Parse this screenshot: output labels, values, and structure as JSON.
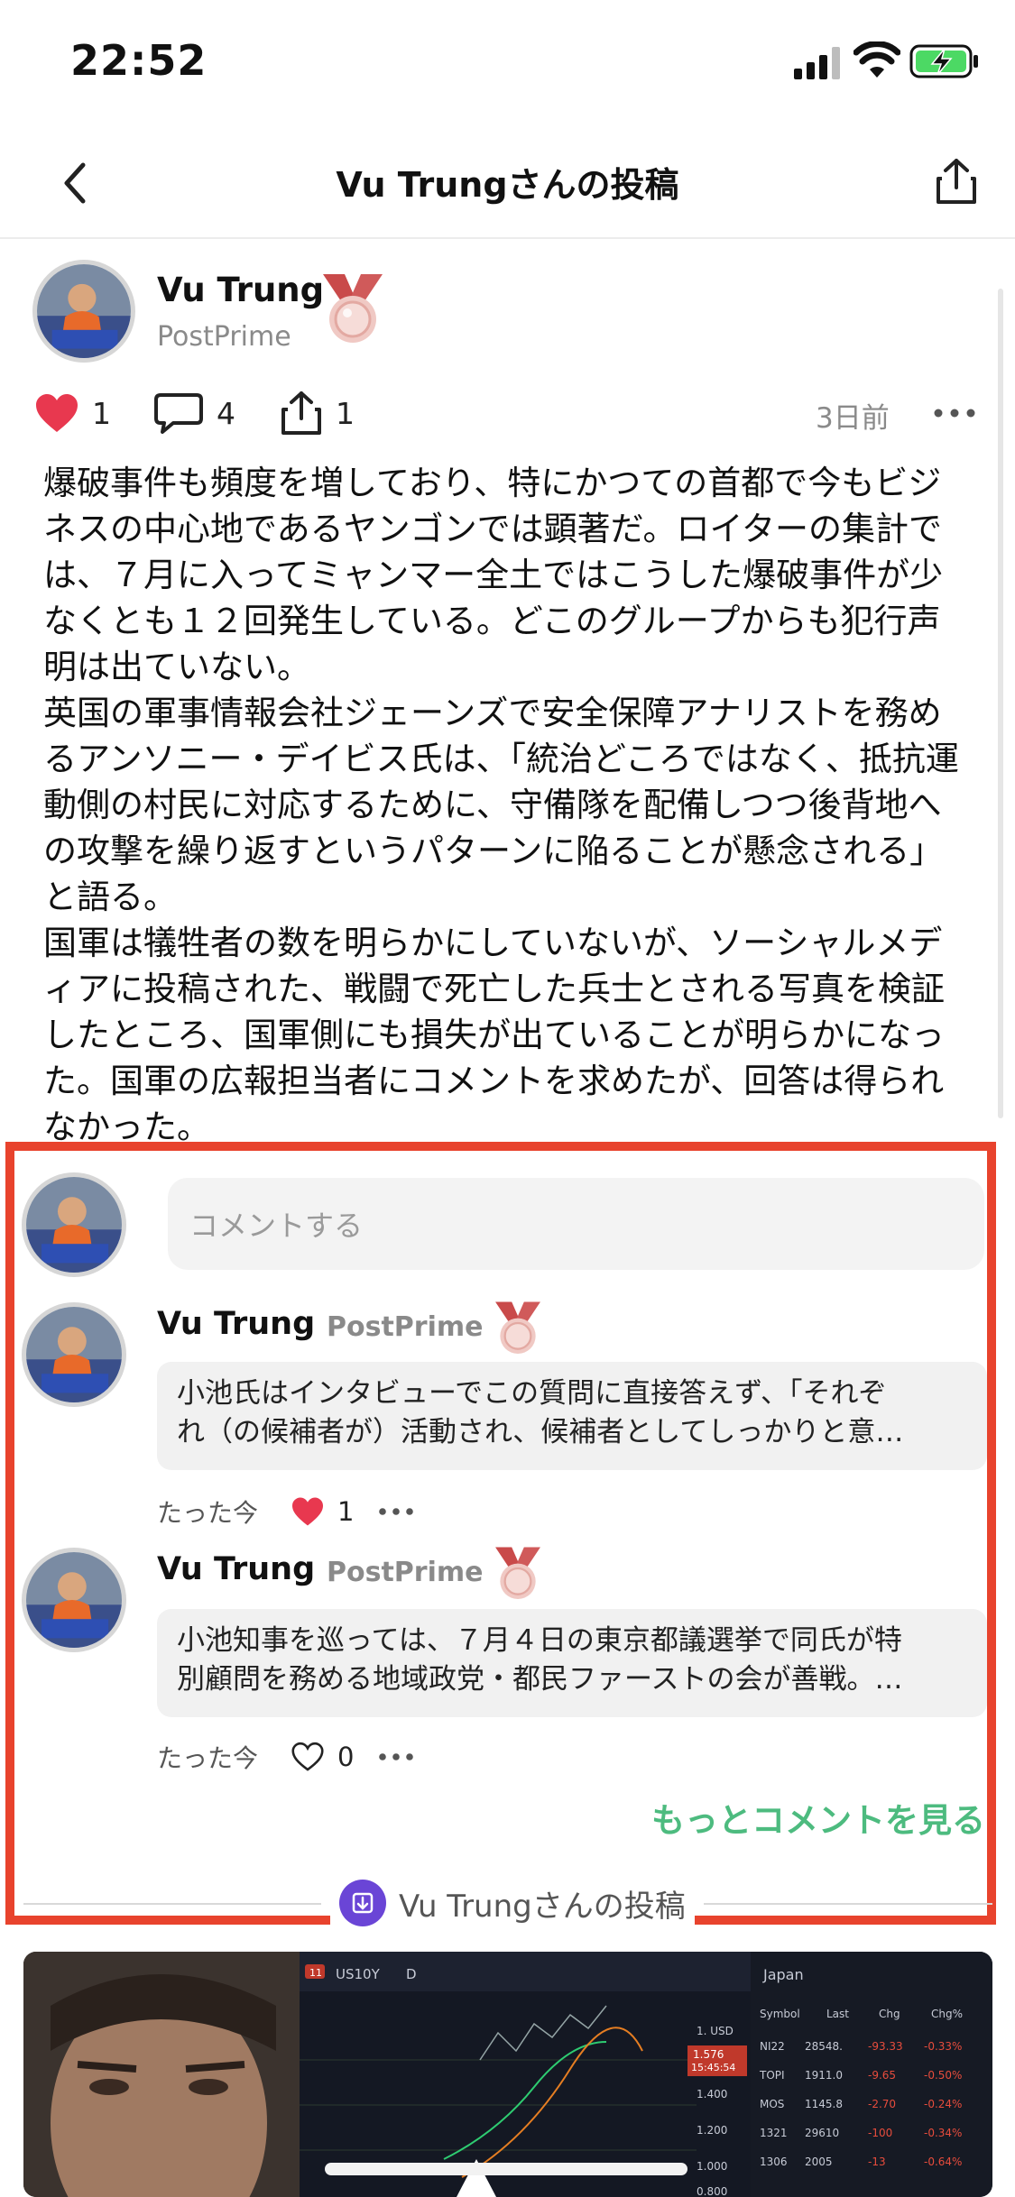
{
  "status": {
    "time": "22:52"
  },
  "nav": {
    "title": "Vu Trungさんの投稿"
  },
  "post": {
    "author": "Vu Trung",
    "subtitle": "PostPrime",
    "likes": "1",
    "comments": "4",
    "shares": "1",
    "time": "3日前",
    "body": [
      "爆破事件も頻度を増しており、特にかつての首都で今もビジネスの中心地であるヤンゴンでは顕著だ。ロイターの集計では、７月に入ってミャンマー全土ではこうした爆破事件が少なくとも１２回発生している。どこのグループからも犯行声明は出ていない。",
      "英国の軍事情報会社ジェーンズで安全保障アナリストを務めるアンソニー・デイビス氏は、「統治どころではなく、抵抗運動側の村民に対応するために、守備隊を配備しつつ後背地への攻撃を繰り返すというパターンに陥ることが懸念される」と語る。",
      "国軍は犠牲者の数を明らかにしていないが、ソーシャルメディアに投稿された、戦闘で死亡した兵士とされる写真を検証したところ、国軍側にも損失が出ていることが明らかになった。国軍の広報担当者にコメントを求めたが、回答は得られなかった。"
    ]
  },
  "comment_input": {
    "placeholder": "コメントする"
  },
  "comments": [
    {
      "author": "Vu Trung",
      "subtitle": "PostPrime",
      "line1": "小池氏はインタビューでこの質問に直接答えず、「それぞ",
      "line2": "れ（の候補者が）活動され、候補者としてしっかりと意…",
      "time": "たった今",
      "likes": "1",
      "liked": true
    },
    {
      "author": "Vu Trung",
      "subtitle": "PostPrime",
      "line1": "小池知事を巡っては、７月４日の東京都議選挙で同氏が特",
      "line2": "別顧問を務める地域政党・都民ファーストの会が善戦。…",
      "time": "たった今",
      "likes": "0",
      "liked": false
    }
  ],
  "more_comments": "もっとコメントを見る",
  "section_label": "Vu Trungさんの投稿",
  "video": {
    "badge": "11",
    "ticker": "US10Y",
    "interval": "D",
    "region": "Japan",
    "columns": [
      "Symbol",
      "Last",
      "Chg",
      "Chg%"
    ],
    "rows": [
      {
        "symbol": "NI22",
        "last": "28548.",
        "chg": "-93.33",
        "pct": "-0.33%"
      },
      {
        "symbol": "TOPI",
        "last": "1911.0",
        "chg": "-9.65",
        "pct": "-0.50%"
      },
      {
        "symbol": "MOS",
        "last": "1145.8",
        "chg": "-2.70",
        "pct": "-0.24%"
      },
      {
        "symbol": "1321",
        "last": "29610",
        "chg": "-100",
        "pct": "-0.34%"
      },
      {
        "symbol": "1306",
        "last": "2005",
        "chg": "-13",
        "pct": "-0.64%"
      }
    ],
    "axis": [
      "1. USD",
      "1.576",
      "1.400",
      "1.200",
      "1.000",
      "0.800"
    ],
    "price_time": "15:45:54"
  },
  "colors": {
    "accent_green": "#4dbb7f",
    "highlight_red": "#e8432d",
    "heart_red": "#e8384f",
    "badge_purple": "#6a45d6"
  }
}
